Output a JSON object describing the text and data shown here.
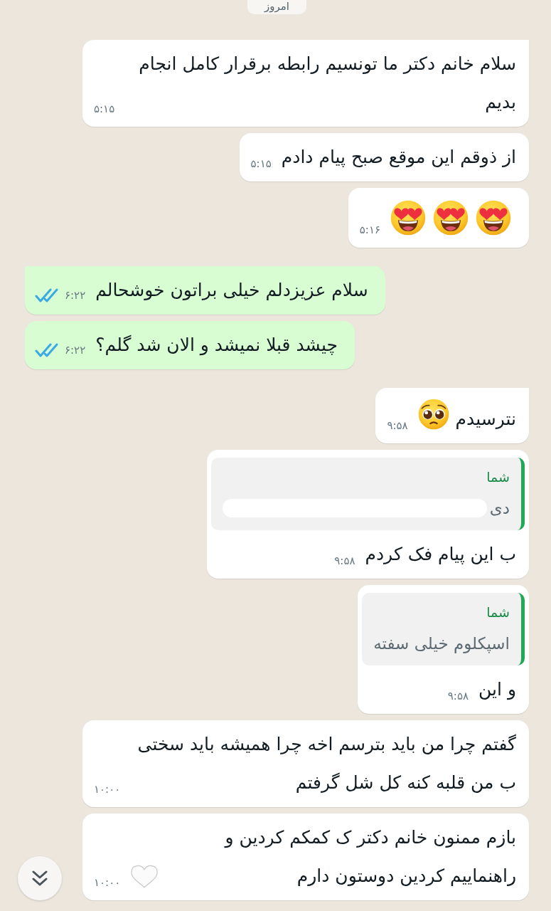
{
  "date_chip": {
    "label": "امروز"
  },
  "messages": [
    {
      "kind": "incoming",
      "tail": true,
      "parts": [
        {
          "kind": "text",
          "text": "سلام خانم دکتر ما تونسیم رابطه برقرار کامل انجام بدیم"
        }
      ],
      "time": "۵:۱۵"
    },
    {
      "kind": "incoming",
      "tail": false,
      "parts": [
        {
          "kind": "text",
          "text": "از ذوقم این موقع صبح پیام دادم"
        }
      ],
      "time": "۵:۱۵"
    },
    {
      "kind": "incoming",
      "tail": false,
      "parts": [
        {
          "kind": "hearteyes"
        },
        {
          "kind": "hearteyes"
        },
        {
          "kind": "hearteyes"
        }
      ],
      "time": "۵:۱۶"
    },
    {
      "kind": "outgoing",
      "tail": true,
      "parts": [
        {
          "kind": "text",
          "text": "سلام عزیزدلم خیلی براتون خوشحالم"
        }
      ],
      "time": "۶:۲۲",
      "read": true
    },
    {
      "kind": "outgoing",
      "tail": false,
      "parts": [
        {
          "kind": "text",
          "text": "چیشد قبلا نمیشد و الان شد گلم؟"
        }
      ],
      "time": "۶:۲۲",
      "read": true
    },
    {
      "kind": "incoming",
      "tail": true,
      "parts": [
        {
          "kind": "text",
          "text": "نترسیدم"
        },
        {
          "kind": "pleading"
        }
      ],
      "time": "۹:۵۸"
    },
    {
      "kind": "incoming",
      "tail": false,
      "quote": {
        "author": "شما",
        "text": "دی",
        "redacted": true
      },
      "parts": [
        {
          "kind": "text",
          "text": "ب این پیام فک کردم"
        }
      ],
      "time": "۹:۵۸"
    },
    {
      "kind": "incoming",
      "tail": false,
      "quote": {
        "author": "شما",
        "text": "اسپکلوم خیلی سفته",
        "redacted": false
      },
      "parts": [
        {
          "kind": "text",
          "text": "و این"
        }
      ],
      "time": "۹:۵۸"
    },
    {
      "kind": "incoming",
      "tail": false,
      "parts": [
        {
          "kind": "text",
          "text": "گفتم چرا من باید بترسم اخه چرا همیشه باید سختی ب من قلبه کنه کل شل گرفتم"
        }
      ],
      "time": "۱۰:۰۰"
    },
    {
      "kind": "incoming",
      "tail": false,
      "parts": [
        {
          "kind": "text",
          "text": "بازم ممنون خانم دکتر ک کمکم کردین و راهنماییم کردین دوستون دارم"
        },
        {
          "kind": "whiteheart"
        }
      ],
      "time": "۱۰:۰۰"
    }
  ]
}
